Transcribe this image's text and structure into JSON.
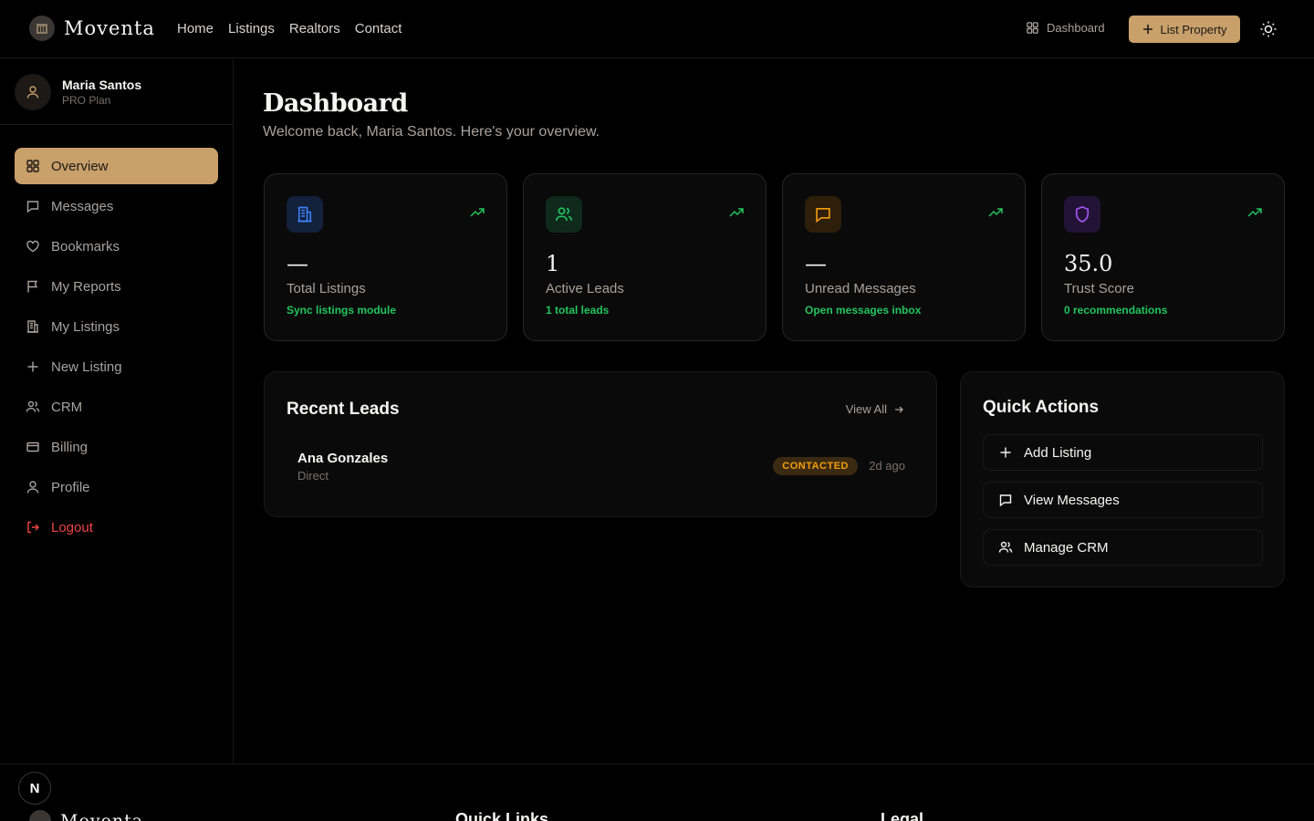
{
  "brand": {
    "name": "Moventa"
  },
  "nav": {
    "links": [
      "Home",
      "Listings",
      "Realtors",
      "Contact"
    ],
    "dashboard": "Dashboard",
    "list_property": "List Property"
  },
  "user": {
    "name": "Maria Santos",
    "plan": "PRO Plan"
  },
  "sidebar": {
    "items": [
      {
        "label": "Overview",
        "icon": "grid-icon",
        "active": true
      },
      {
        "label": "Messages",
        "icon": "message-icon"
      },
      {
        "label": "Bookmarks",
        "icon": "heart-icon"
      },
      {
        "label": "My Reports",
        "icon": "flag-icon"
      },
      {
        "label": "My Listings",
        "icon": "building-icon"
      },
      {
        "label": "New Listing",
        "icon": "plus-icon"
      },
      {
        "label": "CRM",
        "icon": "users-icon"
      },
      {
        "label": "Billing",
        "icon": "credit-card-icon"
      },
      {
        "label": "Profile",
        "icon": "user-icon"
      },
      {
        "label": "Logout",
        "icon": "logout-icon"
      }
    ]
  },
  "page": {
    "title": "Dashboard",
    "subtitle": "Welcome back, Maria Santos. Here's your overview."
  },
  "stats": [
    {
      "value": "—",
      "label": "Total Listings",
      "hint": "Sync listings module",
      "icon": "building-icon",
      "color": "#3b82f6"
    },
    {
      "value": "1",
      "label": "Active Leads",
      "hint": "1 total leads",
      "icon": "users-icon",
      "color": "#22c55e"
    },
    {
      "value": "—",
      "label": "Unread Messages",
      "hint": "Open messages inbox",
      "icon": "message-icon",
      "color": "#f59e0b"
    },
    {
      "value": "35.0",
      "label": "Trust Score",
      "hint": "0 recommendations",
      "icon": "shield-icon",
      "color": "#a855f7"
    }
  ],
  "recent_leads": {
    "title": "Recent Leads",
    "view_all": "View All",
    "leads": [
      {
        "name": "Ana Gonzales",
        "source": "Direct",
        "status": "CONTACTED",
        "time": "2d ago"
      }
    ]
  },
  "quick_actions": {
    "title": "Quick Actions",
    "items": [
      {
        "label": "Add Listing",
        "icon": "plus-icon"
      },
      {
        "label": "View Messages",
        "icon": "message-icon"
      },
      {
        "label": "Manage CRM",
        "icon": "users-icon"
      }
    ]
  },
  "footer": {
    "badge": "N",
    "brand": "Moventa",
    "quick_links": "Quick Links",
    "legal": "Legal"
  }
}
